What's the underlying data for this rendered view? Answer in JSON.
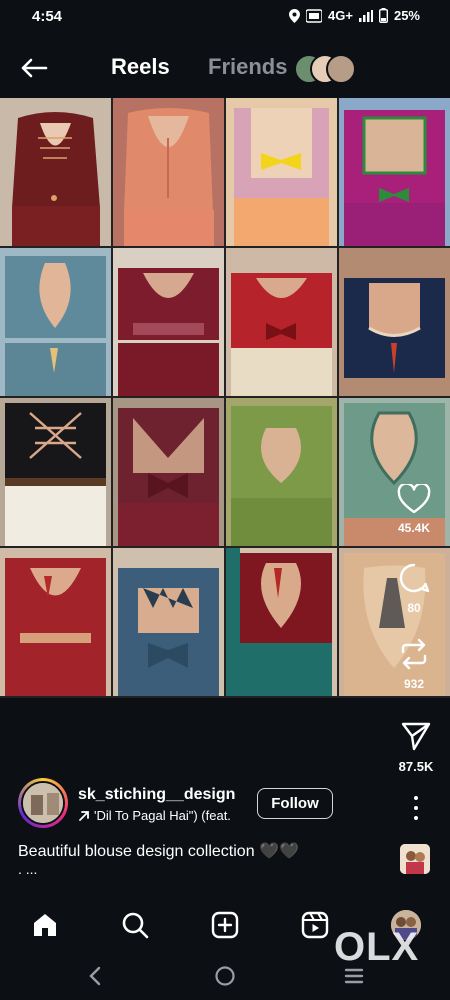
{
  "status_bar": {
    "time": "4:54",
    "network": "4G+",
    "battery": "25%"
  },
  "header": {
    "back_icon": "arrow-left-icon",
    "tab_reels": "Reels",
    "tab_friends": "Friends"
  },
  "reel_actions": {
    "likes": "45.4K",
    "comments": "80",
    "reposts": "932",
    "shares": "87.5K"
  },
  "author": {
    "username": "sk_stiching__design",
    "audio": "'Dil To Pagal Hai\") (feat.",
    "follow_label": "Follow"
  },
  "caption": {
    "text": "Beautiful blouse design collection 🖤🖤",
    "more": ". ..."
  },
  "watermark": "OLX",
  "colors": {
    "background": "#0c0f14",
    "muted_tab": "#8c9096"
  }
}
